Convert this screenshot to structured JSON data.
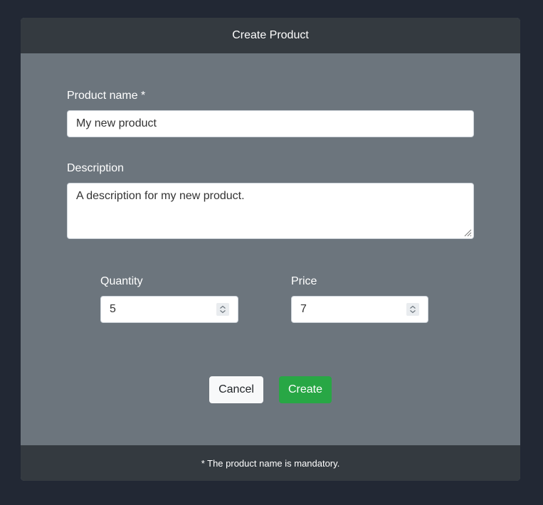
{
  "dialog": {
    "title": "Create Product",
    "footer_note": "* The product name is mandatory."
  },
  "form": {
    "product_name": {
      "label": "Product name *",
      "value": "My new product"
    },
    "description": {
      "label": "Description",
      "value": "A description for my new product."
    },
    "quantity": {
      "label": "Quantity",
      "value": "5"
    },
    "price": {
      "label": "Price",
      "value": "7"
    }
  },
  "actions": {
    "cancel_label": "Cancel",
    "create_label": "Create"
  },
  "colors": {
    "page_background": "#222834",
    "card_body": "#6c757d",
    "card_header_footer": "#343a40",
    "primary_action": "#28a745"
  },
  "icons": {
    "number_spinner": "chevron-up-down-icon",
    "textarea_resize": "resize-grip-icon"
  }
}
